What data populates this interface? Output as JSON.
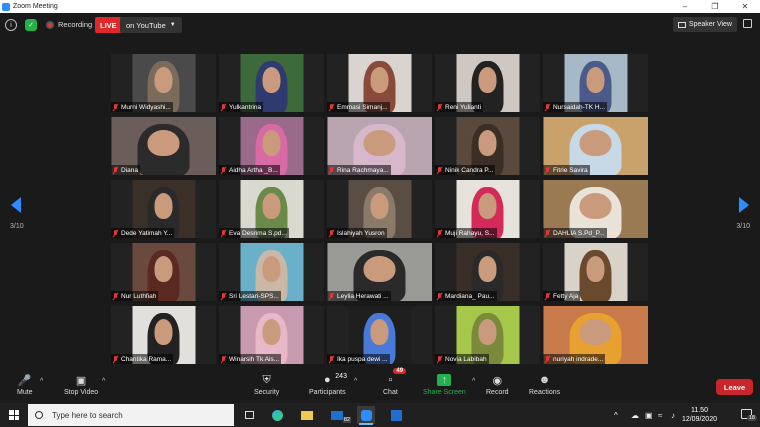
{
  "window": {
    "title": "Zoom Meeting"
  },
  "topbar": {
    "recording_label": "Recording",
    "live_label": "LIVE",
    "stream_label": "on YouTube",
    "view_label": "Speaker View"
  },
  "pagination": {
    "left": "3/10",
    "right": "3/10"
  },
  "participants": [
    {
      "name": "Murni Widyashi...",
      "bg": "#4a4a4a",
      "hijab": "#7a6b5a",
      "wide": false
    },
    {
      "name": "Yulkantrina",
      "bg": "#3d6a3a",
      "hijab": "#2f3b6e",
      "wide": false
    },
    {
      "name": "Emmasi Simanj...",
      "bg": "#d9d4cf",
      "hijab": "#8a4a3a",
      "wide": false
    },
    {
      "name": "Reni Yulianti",
      "bg": "#cfc8c2",
      "hijab": "#222222",
      "wide": false
    },
    {
      "name": "Nursaidah-TK H...",
      "bg": "#a7b8c6",
      "hijab": "#4a5a8a",
      "wide": false
    },
    {
      "name": "Diana",
      "bg": "#6b5e5a",
      "hijab": "#2b2b2b",
      "wide": true
    },
    {
      "name": "Aidha Artha _B...",
      "bg": "#9a6a8a",
      "hijab": "#d86aa6",
      "wide": false
    },
    {
      "name": "Rina Rachmaya...",
      "bg": "#b9a5b0",
      "hijab": "#d6b7cc",
      "wide": true
    },
    {
      "name": "Ninik Candra P...",
      "bg": "#5a4a3e",
      "hijab": "#3a2e26",
      "wide": false
    },
    {
      "name": "Fitrie Savira",
      "bg": "#c8a26a",
      "hijab": "#c7d8e6",
      "wide": true
    },
    {
      "name": "Dede Yatimah Y...",
      "bg": "#3a3028",
      "hijab": "#2a2a2a",
      "wide": false
    },
    {
      "name": "Eva Desrima S.pd...",
      "bg": "#d9d9d0",
      "hijab": "#6a8a4a",
      "wide": false
    },
    {
      "name": "Islahiyah Yusron",
      "bg": "#5a4e44",
      "hijab": "#8a7a6a",
      "wide": false
    },
    {
      "name": "Muji Rahayu, S...",
      "bg": "#e6e2dc",
      "hijab": "#d42a5a",
      "wide": false
    },
    {
      "name": "DAHLIA S.Pd_P...",
      "bg": "#9a7a52",
      "hijab": "#e8e2d8",
      "wide": true
    },
    {
      "name": "Nur Luthfiah",
      "bg": "#6a4a3e",
      "hijab": "#5a2a22",
      "wide": false
    },
    {
      "name": "Sri Lestari-SPS...",
      "bg": "#6ab0c8",
      "hijab": "#c9b8a6",
      "wide": false
    },
    {
      "name": "Leylia Herawati ...",
      "bg": "#9a9a96",
      "hijab": "#2a2a2a",
      "wide": true
    },
    {
      "name": "Mardiana_ Pau...",
      "bg": "#3a2e28",
      "hijab": "#2a2a2a",
      "wide": false
    },
    {
      "name": "Fetty Aja",
      "bg": "#d8d2c8",
      "hijab": "#6a4a2e",
      "wide": false
    },
    {
      "name": "Chantika Rama...",
      "bg": "#e2e0dc",
      "hijab": "#222222",
      "wide": false
    },
    {
      "name": "Winarsih Tk Ais...",
      "bg": "#c89ab0",
      "hijab": "#e8b8c8",
      "wide": false
    },
    {
      "name": "Ika puspa dewi ...",
      "bg": "#1e1e1e",
      "hijab": "#4a7ad8",
      "wide": false
    },
    {
      "name": "Novia Labibah",
      "bg": "#a6c84a",
      "hijab": "#7a8a3a",
      "wide": false
    },
    {
      "name": "nuriyah indrade...",
      "bg": "#c87a4a",
      "hijab": "#e8a030",
      "wide": true
    }
  ],
  "toolbar": {
    "mute_label": "Mute",
    "video_label": "Stop Video",
    "security_label": "Security",
    "participants_label": "Participants",
    "participants_count": "243",
    "chat_label": "Chat",
    "chat_count": "49",
    "share_label": "Share Screen",
    "record_label": "Record",
    "reactions_label": "Reactions",
    "leave_label": "Leave"
  },
  "taskbar": {
    "search_placeholder": "Type here to search",
    "mail_count": "82",
    "time": "11.50",
    "date": "12/09/2020",
    "notification_count": "18"
  },
  "colors": {
    "accent": "#2d8cff",
    "live": "#e02828",
    "share": "#23b14d",
    "leave": "#c8262b"
  }
}
